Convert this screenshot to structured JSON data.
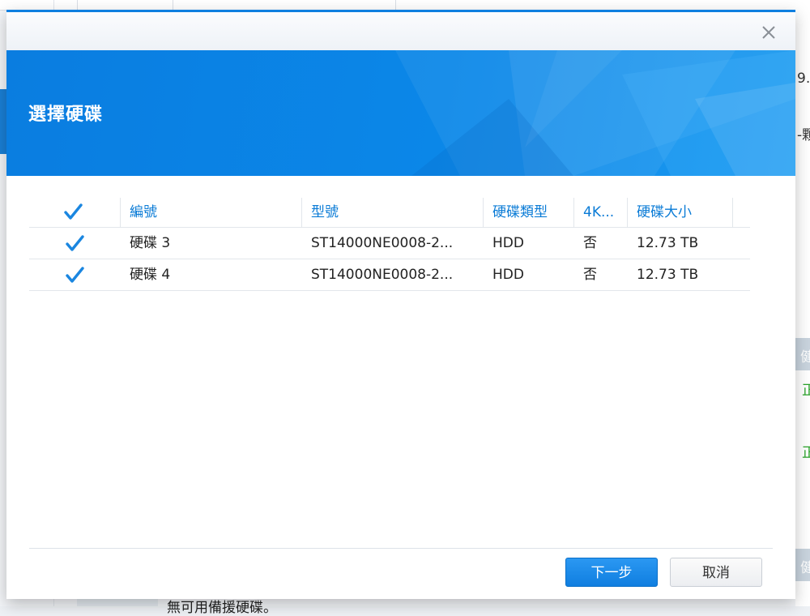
{
  "dialog": {
    "title": "選擇硬碟",
    "next_label": "下一步",
    "cancel_label": "取消"
  },
  "table": {
    "columns": [
      "編號",
      "型號",
      "硬碟類型",
      "4K...",
      "硬碟大小"
    ],
    "rows": [
      {
        "id": "硬碟 3",
        "model": "ST14000NE0008-2...",
        "type": "HDD",
        "fourk": "否",
        "size": "12.73 TB",
        "checked": true
      },
      {
        "id": "硬碟 4",
        "model": "ST14000NE0008-2...",
        "type": "HDD",
        "fourk": "否",
        "size": "12.73 TB",
        "checked": true
      }
    ],
    "select_all_checked": true
  },
  "background": {
    "right_text_1": "9.",
    "right_text_2": "-顆",
    "right_band_1": "健",
    "right_green_1": "正",
    "right_green_2": "正",
    "right_band_2": "健",
    "bottom_text": "無可用備援硬碟。"
  },
  "colors": {
    "accent": "#0a7bd6",
    "check": "#1a86e0",
    "primary_button": "#1a88e8"
  },
  "icons": {
    "close": "close-icon",
    "checkbox": "checkmark-icon"
  }
}
